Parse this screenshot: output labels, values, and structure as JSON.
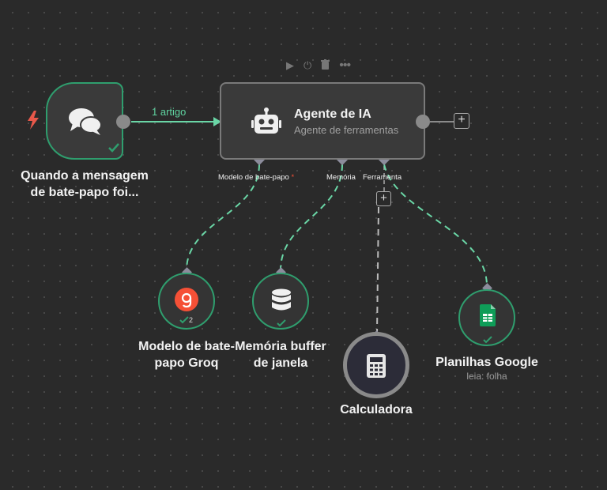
{
  "toolbar": {
    "play_icon": "play-icon",
    "power_icon": "power-icon",
    "delete_icon": "trash-icon",
    "more_icon": "more-icon"
  },
  "trigger": {
    "title_line1": "Quando a mensagem",
    "title_line2": "de bate-papo foi...",
    "icon": "chat-bubbles-icon",
    "status_icon": "check-icon",
    "trigger_icon": "lightning-icon"
  },
  "edge": {
    "label": "1 artigo"
  },
  "agent": {
    "title": "Agente de IA",
    "subtitle": "Agente de ferramentas",
    "icon": "robot-icon",
    "ports": {
      "chat_model": "Modelo de bate-papo",
      "required_marker": "*",
      "memory": "Memória",
      "tool": "Ferramenta"
    }
  },
  "sub_nodes": {
    "groq": {
      "title_line1": "Modelo de bate-",
      "title_line2": "papo Groq",
      "badge": "2"
    },
    "memory": {
      "title_line1": "Memória buffer",
      "title_line2": "de janela"
    },
    "calculator": {
      "title": "Calculadora"
    },
    "sheets": {
      "title": "Planilhas Google",
      "subtitle": "leia: folha"
    }
  },
  "colors": {
    "success": "#2f9e6e",
    "connection": "#6ad6a6",
    "groq": "#f55036",
    "sheets": "#0f9d58",
    "trigger_bolt": "#e8584a"
  }
}
